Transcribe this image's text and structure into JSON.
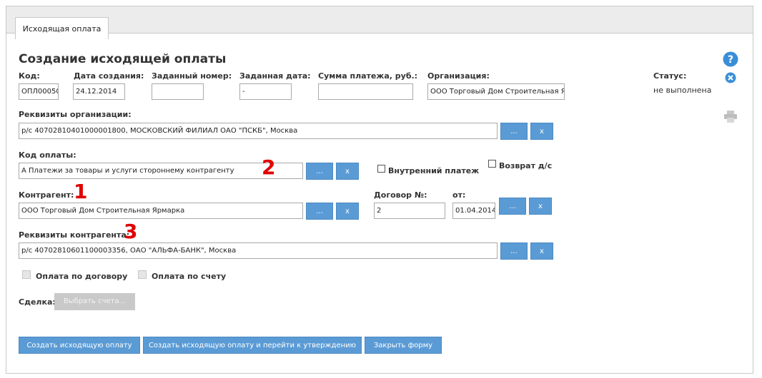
{
  "tab": {
    "label": "Исходящая оплата"
  },
  "page_title": "Создание исходящей оплаты",
  "fields": {
    "code": {
      "label": "Код:",
      "value": "ОПЛ00050("
    },
    "created": {
      "label": "Дата создания:",
      "value": "24.12.2014"
    },
    "set_number": {
      "label": "Заданный номер:",
      "value": ""
    },
    "set_date": {
      "label": "Заданная дата:",
      "value": "-"
    },
    "amount": {
      "label": "Сумма платежа, руб.:",
      "value": ""
    },
    "organization": {
      "label": "Организация:",
      "value": "ООО Торговый Дом Строительная Я"
    },
    "status": {
      "label": "Статус:",
      "value": "не выполнена"
    },
    "org_requisites": {
      "label": "Реквизиты организации:",
      "value": "р/с 40702810401000001800, МОСКОВСКИЙ ФИЛИАЛ ОАО \"ПСКБ\", Москва"
    },
    "payment_code": {
      "label": "Код оплаты:",
      "value": "А Платежи за товары и услуги стороннему контрагенту"
    },
    "internal_payment": {
      "label": "Внутренний платеж",
      "checked": false
    },
    "refund": {
      "label": "Возврат д/с",
      "checked": false
    },
    "counterparty": {
      "label": "Контрагент:",
      "value": "ООО Торговый Дом Строительная Ярмарка"
    },
    "contract_no": {
      "label": "Договор №:",
      "value": "2"
    },
    "contract_from": {
      "label": "от:",
      "value": "01.04.2014"
    },
    "cp_requisites": {
      "label": "Реквизиты контрагента:",
      "value": "р/с 40702810601100003356, ОАО \"АЛЬФА-БАНК\", Москва"
    },
    "pay_by_contract": {
      "label": "Оплата по договору"
    },
    "pay_by_invoice": {
      "label": "Оплата по счету"
    },
    "deal": {
      "label": "Сделка:",
      "button": "Выбрать счета..."
    }
  },
  "small_buttons": {
    "browse": "...",
    "clear": "x"
  },
  "annotations": {
    "n1": "1",
    "n2": "2",
    "n3": "3"
  },
  "actions": {
    "create": "Создать исходящую оплату",
    "create_approve": "Создать исходящую оплату и перейти к утверждению",
    "close": "Закрыть форму"
  },
  "icons": {
    "help": "help-icon",
    "close": "close-circle-icon",
    "print": "printer-icon"
  },
  "colors": {
    "primary_button": "#5b9bd5",
    "annotation": "#e00000",
    "icon_blue": "#3a8ed8"
  }
}
